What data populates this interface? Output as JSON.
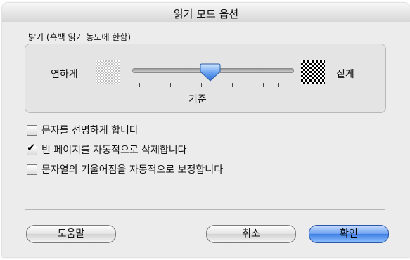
{
  "dialog": {
    "title": "읽기 모드 옵션"
  },
  "brightness": {
    "group_label": "밝기 (흑백 읽기 농도에 한함)",
    "light_label": "연하게",
    "dark_label": "짙게",
    "center_label": "기준",
    "value_fraction": 0.5
  },
  "options": [
    {
      "label": "문자를 선명하게 합니다",
      "checked": false
    },
    {
      "label": "빈 페이지를 자동적으로 삭제합니다",
      "checked": true
    },
    {
      "label": "문자열의 기울어짐을 자동적으로 보정합니다",
      "checked": false
    }
  ],
  "buttons": {
    "help": "도움말",
    "cancel": "취소",
    "ok": "확인"
  },
  "colors": {
    "default_button": "#3f7fe4",
    "slider_thumb": "#4a8be6"
  }
}
